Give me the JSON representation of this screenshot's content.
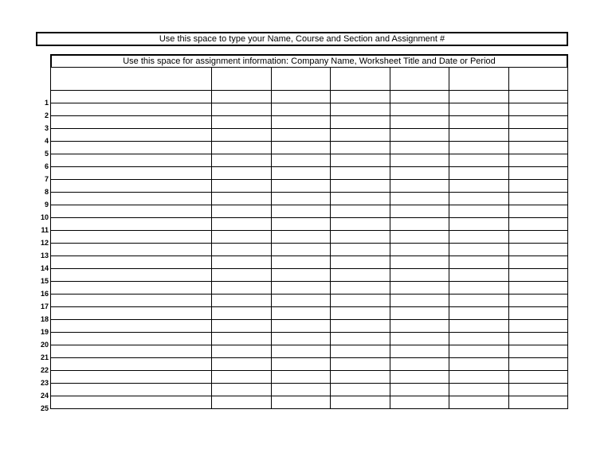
{
  "header": {
    "line1": "Use this space to type your Name, Course and Section and Assignment #",
    "line2": "Use this space for assignment information: Company Name, Worksheet Title and Date or Period"
  },
  "grid": {
    "columns": 7,
    "rows": 25,
    "row_labels": [
      "1",
      "2",
      "3",
      "4",
      "5",
      "6",
      "7",
      "8",
      "9",
      "10",
      "11",
      "12",
      "13",
      "14",
      "15",
      "16",
      "17",
      "18",
      "19",
      "20",
      "21",
      "22",
      "23",
      "24",
      "25"
    ]
  }
}
